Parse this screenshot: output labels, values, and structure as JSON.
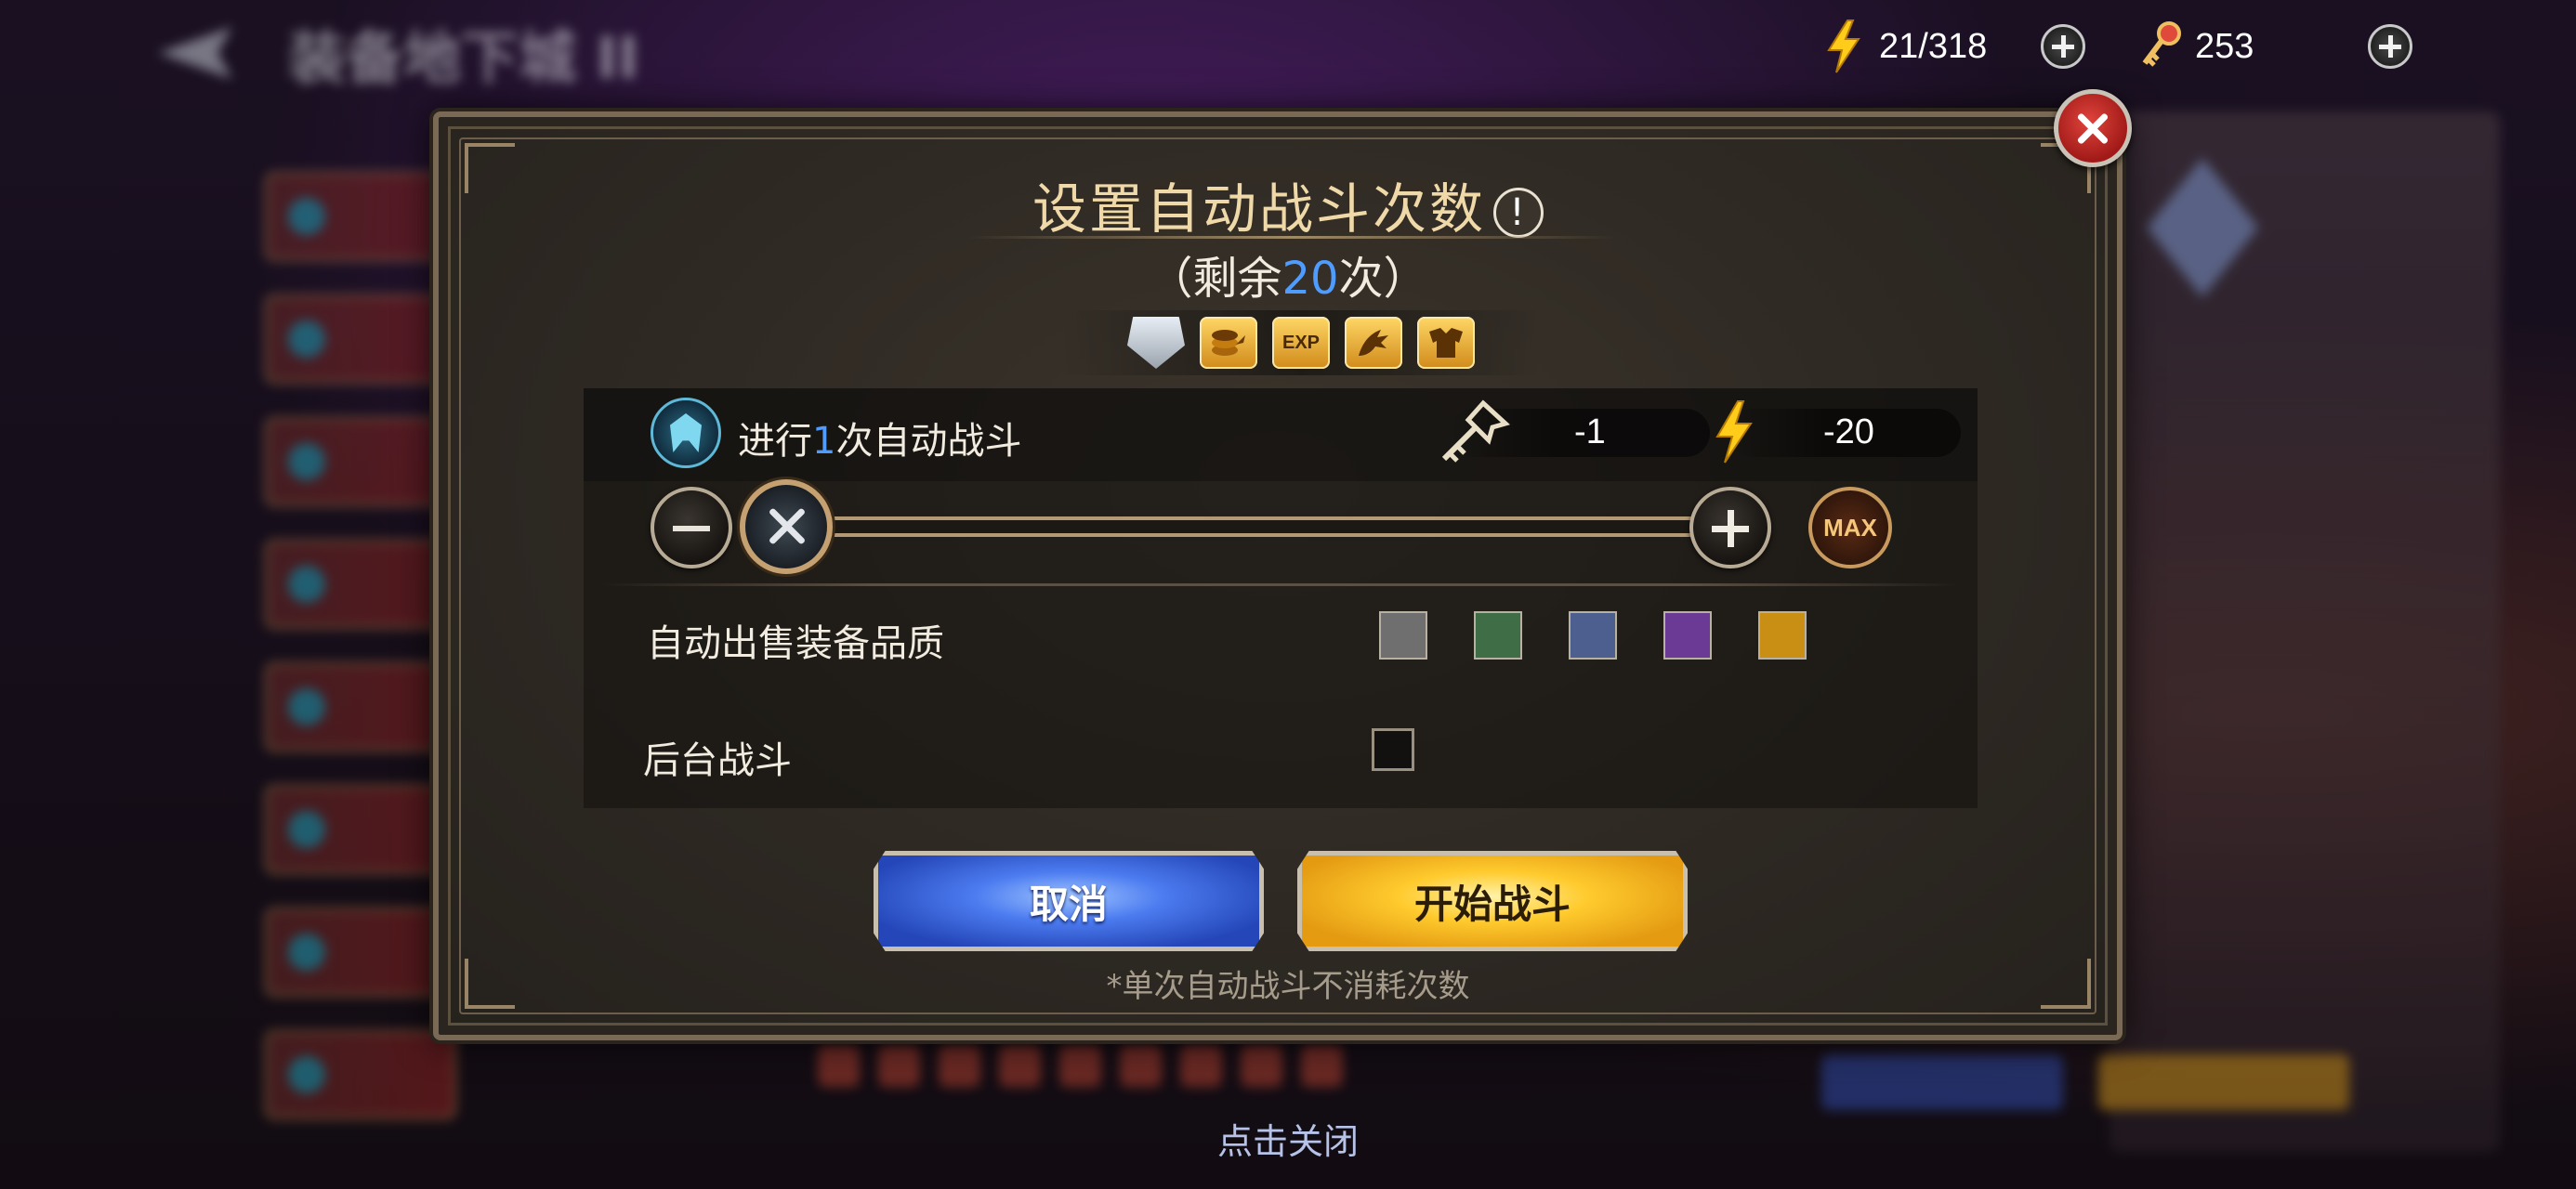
{
  "background": {
    "title": "装备地下城 II"
  },
  "resources": {
    "energy": "21/318",
    "keys": "253"
  },
  "dialog": {
    "title": "设置自动战斗次数",
    "info_glyph": "!",
    "remaining_prefix": "（剩余",
    "remaining_count": "20",
    "remaining_suffix": "次）",
    "rewards": [
      "shield-badge",
      "gold-coins",
      "EXP",
      "dragon",
      "armor"
    ],
    "rewards_exp_label": "EXP",
    "auto_prefix": "进行",
    "auto_count": "1",
    "auto_suffix": "次自动战斗",
    "key_cost": "-1",
    "energy_cost": "-20",
    "slider": {
      "value": 1,
      "max": 20
    },
    "max_label": "MAX",
    "auto_sell_label": "自动出售装备品质",
    "quality_colors": [
      "#6f6f6f",
      "#3f6e46",
      "#4d5f8f",
      "#6a3a94",
      "#c98f14"
    ],
    "background_battle_label": "后台战斗",
    "background_battle_checked": false,
    "cancel_label": "取消",
    "start_label": "开始战斗",
    "note": "*单次自动战斗不消耗次数"
  },
  "tap_to_close": "点击关闭"
}
